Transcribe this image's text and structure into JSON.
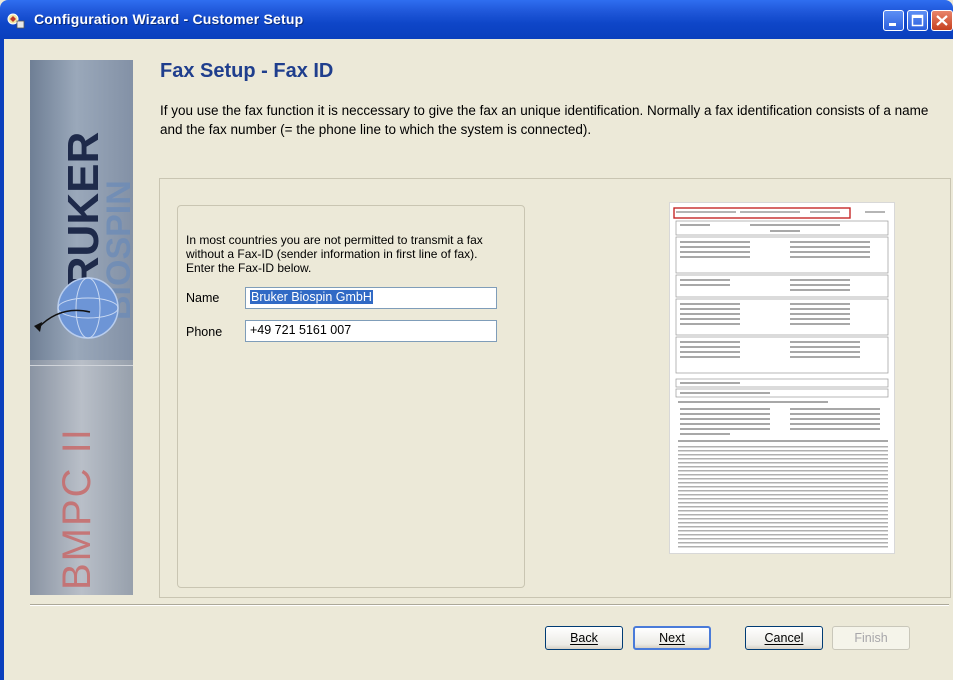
{
  "window": {
    "title": "Configuration Wizard - Customer Setup"
  },
  "sidebar": {
    "brand_top": "BRUKER",
    "brand_sub": "BIOSPIN",
    "product": "BMPC II"
  },
  "page": {
    "title": "Fax Setup - Fax ID",
    "intro": "If you use the fax function it is neccessary to give the fax an unique identification. Normally a fax identification consists of a name and the fax number (= the phone line to which the system is connected).",
    "note": "In most countries you are not permitted to transmit a fax without a Fax-ID (sender information in first line of fax). Enter the Fax-ID below."
  },
  "form": {
    "name_label": "Name",
    "name_value": "Bruker Biospin GmbH",
    "phone_label": "Phone",
    "phone_value": "+49 721 5161 007"
  },
  "buttons": {
    "back": "Back",
    "next": "Next",
    "cancel": "Cancel",
    "finish": "Finish"
  },
  "colors": {
    "title_blue": "#1f3e8d",
    "titlebar": "#0a3fbd"
  }
}
